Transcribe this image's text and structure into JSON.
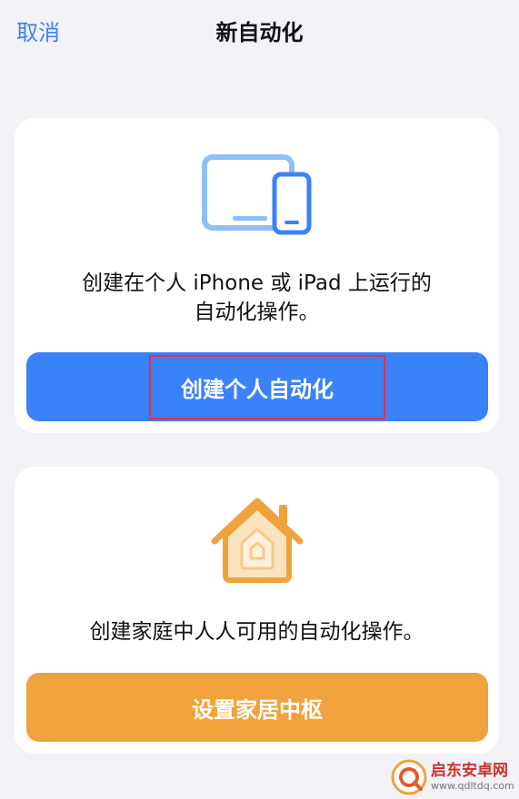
{
  "navbar": {
    "cancel_label": "取消",
    "title": "新自动化"
  },
  "personal": {
    "icon": "devices-icon",
    "desc_line1": "创建在个人 iPhone 或 iPad 上运行的",
    "desc_line2": "自动化操作。",
    "button_label": "创建个人自动化",
    "button_color": "#3a82f7",
    "highlight_color": "#e0324c"
  },
  "home": {
    "icon": "home-icon",
    "desc": "创建家庭中人人可用的自动化操作。",
    "button_label": "设置家居中枢",
    "button_color": "#f0a23c"
  },
  "watermark": {
    "name": "启东安卓网",
    "url": "www.qdltdq.com"
  }
}
